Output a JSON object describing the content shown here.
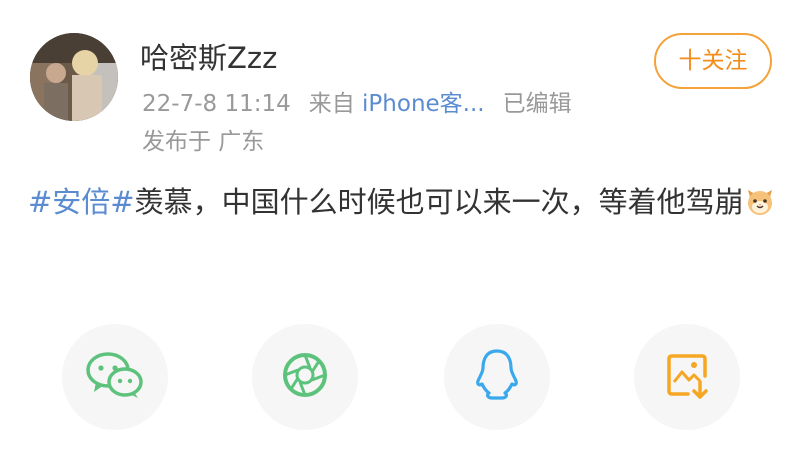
{
  "post": {
    "author": "哈密斯Zzz",
    "timestamp": "22-7-8 11:14",
    "source_prefix": "来自",
    "source": "iPhone客...",
    "edited": "已编辑",
    "location": "发布于 广东",
    "hashtag": "#安倍#",
    "body": "羡慕，中国什么时候也可以来一次，等着他驾崩",
    "emoji_icon": "cat-face-emoji-icon"
  },
  "follow_button": {
    "label": "十关注",
    "color": "#f5a23a"
  },
  "share_bar": {
    "items": [
      {
        "icon": "wechat-icon",
        "color": "#5dc27b"
      },
      {
        "icon": "moments-icon",
        "color": "#5dc27b"
      },
      {
        "icon": "qq-icon",
        "color": "#3aa8ec"
      },
      {
        "icon": "save-image-icon",
        "color": "#f5a623"
      }
    ]
  },
  "colors": {
    "link": "#5b8bd0",
    "text": "#333333",
    "meta": "#999999"
  }
}
